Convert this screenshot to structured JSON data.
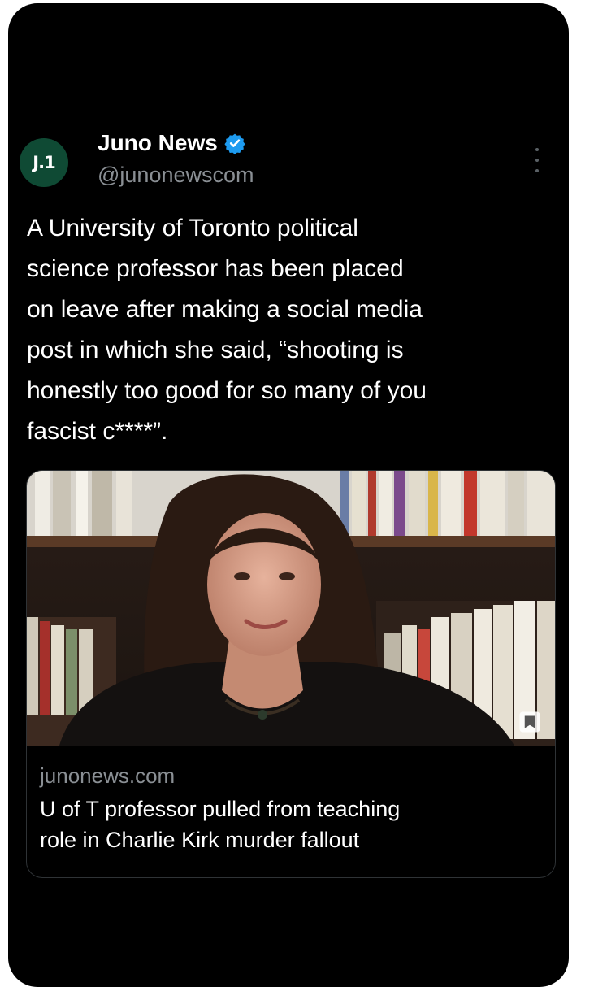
{
  "post": {
    "author": {
      "avatar_text": "J.1",
      "display_name": "Juno News",
      "handle": "@junonewscom",
      "verified": true
    },
    "text": "A University of Toronto political\nscience professor has been placed\non leave after making a social media\npost in which she said, “shooting is\nhonestly too good for so many of you\nfascist c****”.",
    "link_card": {
      "domain": "junonews.com",
      "title": "U of T professor pulled from teaching\nrole in Charlie Kirk murder fallout"
    }
  },
  "colors": {
    "background": "#000000",
    "avatar": "#0f4a34",
    "verified": "#1d9bf0",
    "secondary_text": "#8a8f94"
  },
  "icons": [
    "verified-badge-icon",
    "more-options-icon",
    "bookmark-icon"
  ]
}
